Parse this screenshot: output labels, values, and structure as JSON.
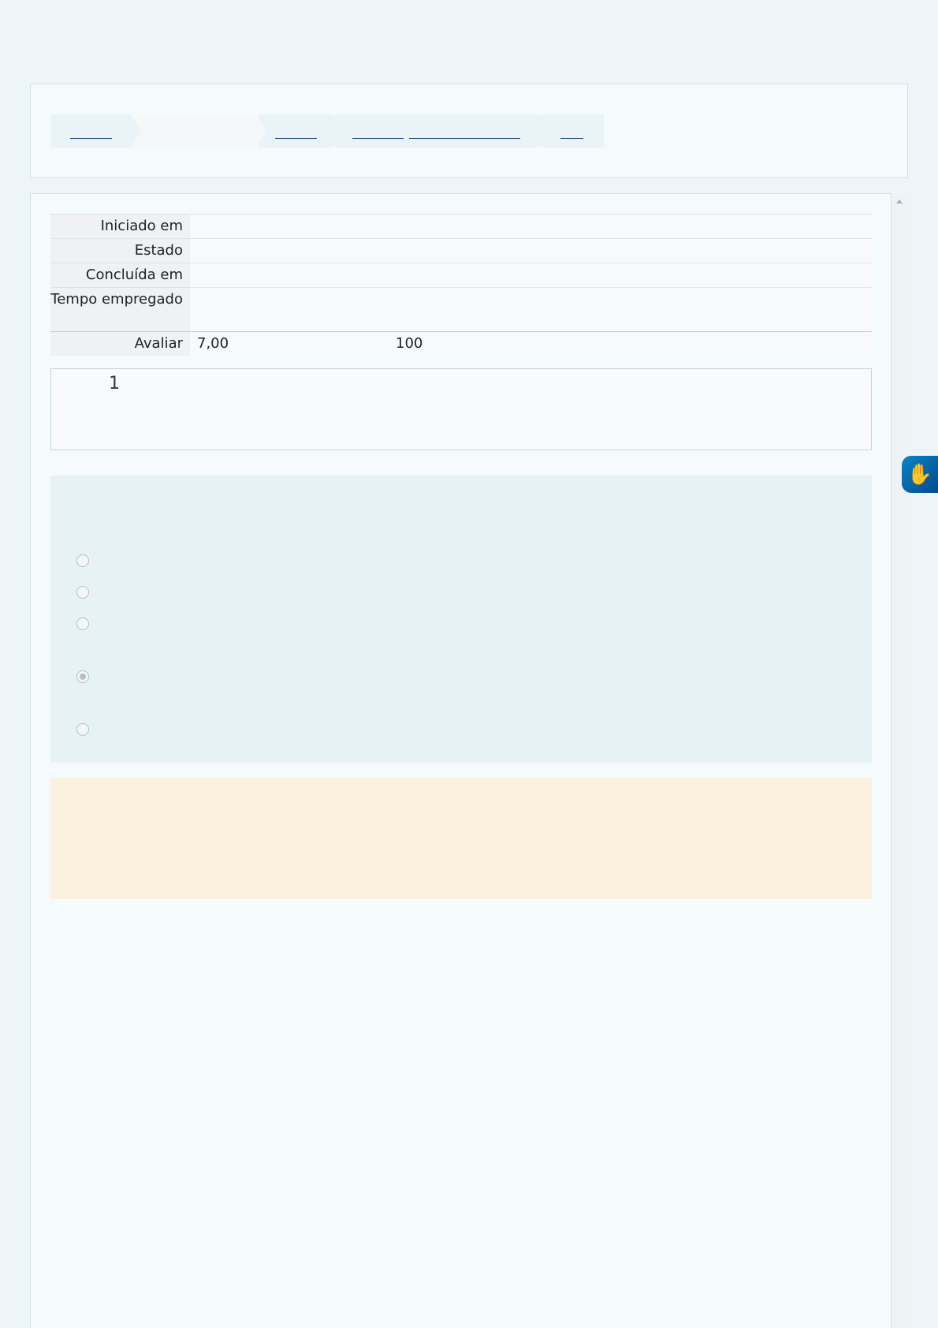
{
  "breadcrumb": {
    "items": [
      {
        "state": "link"
      },
      {
        "state": "current"
      },
      {
        "state": "link"
      },
      {
        "state": "link"
      },
      {
        "state": "link"
      }
    ]
  },
  "summary": {
    "rows": [
      {
        "label": "Iniciado em",
        "value": ""
      },
      {
        "label": "Estado",
        "value": ""
      },
      {
        "label": "Concluída em",
        "value": ""
      },
      {
        "label": "Tempo empregado",
        "value": ""
      }
    ],
    "grade": {
      "label": "Avaliar",
      "value": "7,00",
      "max": "100"
    }
  },
  "question": {
    "number": "1"
  },
  "answers": {
    "options": [
      {
        "selected": false
      },
      {
        "selected": false
      },
      {
        "selected": false
      },
      {
        "selected": true
      },
      {
        "selected": false
      }
    ]
  },
  "accessibility": {
    "icon": "sign-language-hands-icon"
  },
  "colors": {
    "page_background": "#edf5f8",
    "answer_panel": "#e6f2f5",
    "feedback_panel": "#fcf0df",
    "accessibility_button": "#0a6fb3"
  }
}
